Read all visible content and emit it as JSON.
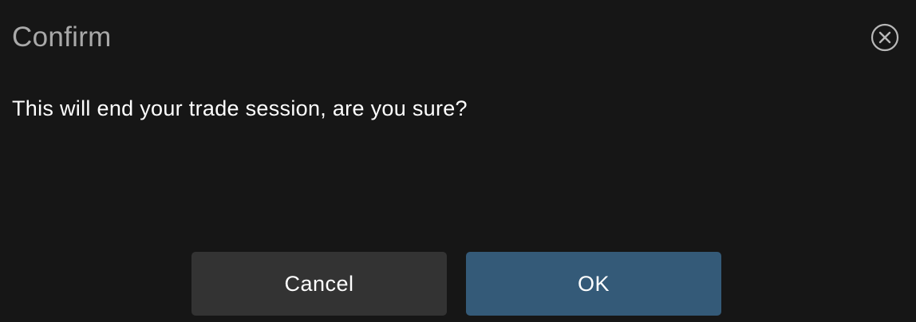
{
  "dialog": {
    "title": "Confirm",
    "message": "This will end your trade session, are you sure?",
    "cancel_label": "Cancel",
    "ok_label": "OK",
    "close_icon": "close-circle-icon"
  },
  "colors": {
    "background": "#161616",
    "title": "#a9a9a9",
    "text": "#ffffff",
    "cancel_button": "#333333",
    "ok_button": "#345a78"
  }
}
